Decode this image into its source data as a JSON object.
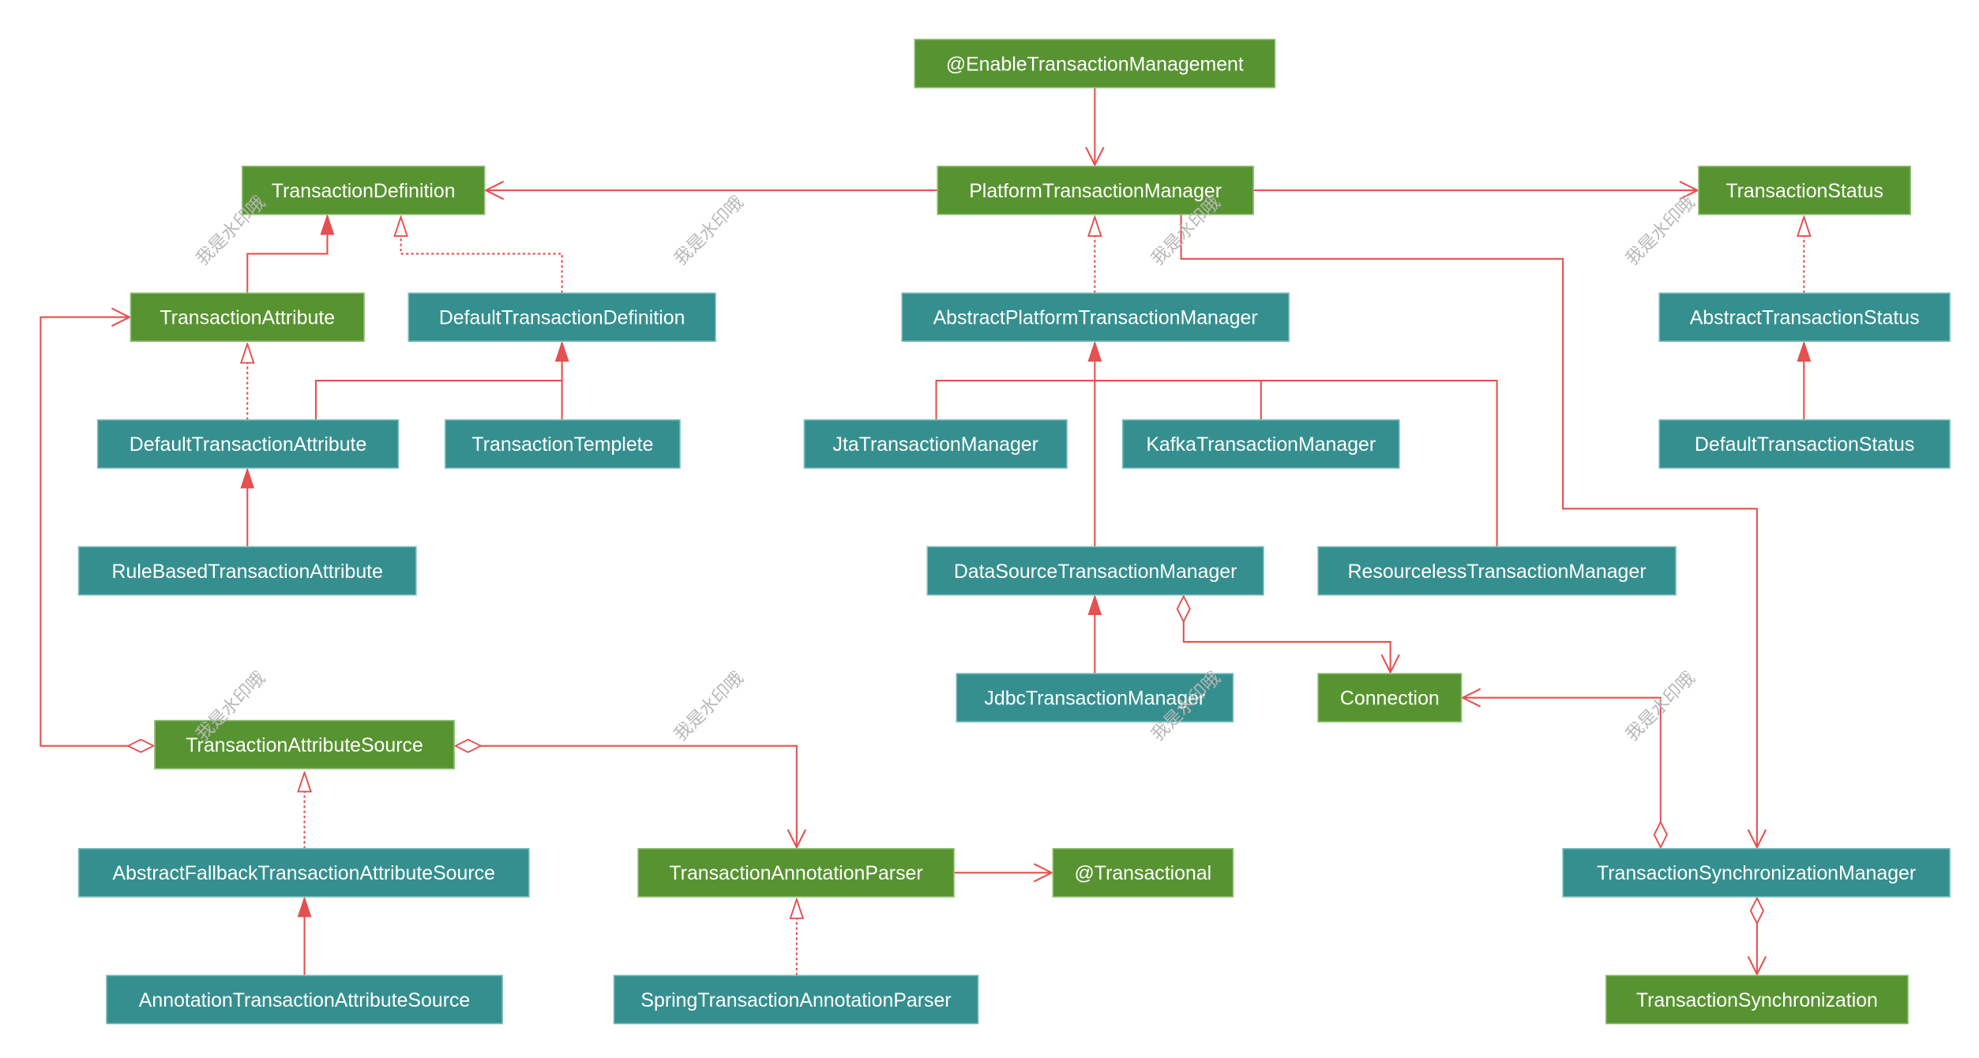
{
  "colors": {
    "interface": "#589331",
    "class": "#368f8f",
    "border_interface": "#8fbf74",
    "border_class": "#7dbdbd",
    "edge": "#e55050",
    "background": "#ffffff"
  },
  "watermark": "我是水印哦",
  "nodes": [
    {
      "id": "enable",
      "label": "@EnableTransactionManagement",
      "kind": "interface"
    },
    {
      "id": "td",
      "label": "TransactionDefinition",
      "kind": "interface"
    },
    {
      "id": "ptm",
      "label": "PlatformTransactionManager",
      "kind": "interface"
    },
    {
      "id": "ts",
      "label": "TransactionStatus",
      "kind": "interface"
    },
    {
      "id": "ta",
      "label": "TransactionAttribute",
      "kind": "interface"
    },
    {
      "id": "dtd",
      "label": "DefaultTransactionDefinition",
      "kind": "class"
    },
    {
      "id": "aptm",
      "label": "AbstractPlatformTransactionManager",
      "kind": "class"
    },
    {
      "id": "ats",
      "label": "AbstractTransactionStatus",
      "kind": "class"
    },
    {
      "id": "dta",
      "label": "DefaultTransactionAttribute",
      "kind": "class"
    },
    {
      "id": "tt",
      "label": "TransactionTemplete",
      "kind": "class"
    },
    {
      "id": "jta",
      "label": "JtaTransactionManager",
      "kind": "class"
    },
    {
      "id": "kafka",
      "label": "KafkaTransactionManager",
      "kind": "class"
    },
    {
      "id": "dts",
      "label": "DefaultTransactionStatus",
      "kind": "class"
    },
    {
      "id": "rbta",
      "label": "RuleBasedTransactionAttribute",
      "kind": "class"
    },
    {
      "id": "dstm",
      "label": "DataSourceTransactionManager",
      "kind": "class"
    },
    {
      "id": "rtm",
      "label": "ResourcelessTransactionManager",
      "kind": "class"
    },
    {
      "id": "jdbc",
      "label": "JdbcTransactionManager",
      "kind": "class"
    },
    {
      "id": "conn",
      "label": "Connection",
      "kind": "interface"
    },
    {
      "id": "tas",
      "label": "TransactionAttributeSource",
      "kind": "interface"
    },
    {
      "id": "aftas",
      "label": "AbstractFallbackTransactionAttributeSource",
      "kind": "class"
    },
    {
      "id": "tap",
      "label": "TransactionAnnotationParser",
      "kind": "interface"
    },
    {
      "id": "tx",
      "label": "@Transactional",
      "kind": "interface"
    },
    {
      "id": "tsm",
      "label": "TransactionSynchronizationManager",
      "kind": "class"
    },
    {
      "id": "atas",
      "label": "AnnotationTransactionAttributeSource",
      "kind": "class"
    },
    {
      "id": "stap",
      "label": "SpringTransactionAnnotationParser",
      "kind": "class"
    },
    {
      "id": "tsync",
      "label": "TransactionSynchronization",
      "kind": "interface"
    }
  ],
  "edges": [
    {
      "from": "enable",
      "to": "ptm",
      "type": "association"
    },
    {
      "from": "ptm",
      "to": "td",
      "type": "association"
    },
    {
      "from": "ptm",
      "to": "ts",
      "type": "association"
    },
    {
      "from": "ptm",
      "to": "tsm",
      "type": "association"
    },
    {
      "from": "ta",
      "to": "td",
      "type": "generalization"
    },
    {
      "from": "dtd",
      "to": "td",
      "type": "realization"
    },
    {
      "from": "aptm",
      "to": "ptm",
      "type": "realization"
    },
    {
      "from": "ats",
      "to": "ts",
      "type": "realization"
    },
    {
      "from": "dta",
      "to": "ta",
      "type": "realization"
    },
    {
      "from": "dta",
      "to": "dtd",
      "type": "generalization"
    },
    {
      "from": "tt",
      "to": "dtd",
      "type": "generalization"
    },
    {
      "from": "jta",
      "to": "aptm",
      "type": "generalization"
    },
    {
      "from": "kafka",
      "to": "aptm",
      "type": "generalization"
    },
    {
      "from": "rtm",
      "to": "aptm",
      "type": "generalization"
    },
    {
      "from": "dstm",
      "to": "aptm",
      "type": "generalization"
    },
    {
      "from": "dts",
      "to": "ats",
      "type": "generalization"
    },
    {
      "from": "rbta",
      "to": "dta",
      "type": "generalization"
    },
    {
      "from": "jdbc",
      "to": "dstm",
      "type": "generalization"
    },
    {
      "from": "dstm",
      "to": "conn",
      "type": "aggregation"
    },
    {
      "from": "tsm",
      "to": "conn",
      "type": "aggregation"
    },
    {
      "from": "tsm",
      "to": "tsync",
      "type": "aggregation"
    },
    {
      "from": "tas",
      "to": "ta",
      "type": "aggregation"
    },
    {
      "from": "tas",
      "to": "tap",
      "type": "aggregation"
    },
    {
      "from": "aftas",
      "to": "tas",
      "type": "realization"
    },
    {
      "from": "atas",
      "to": "aftas",
      "type": "generalization"
    },
    {
      "from": "tap",
      "to": "tx",
      "type": "association"
    },
    {
      "from": "stap",
      "to": "tap",
      "type": "realization"
    }
  ]
}
